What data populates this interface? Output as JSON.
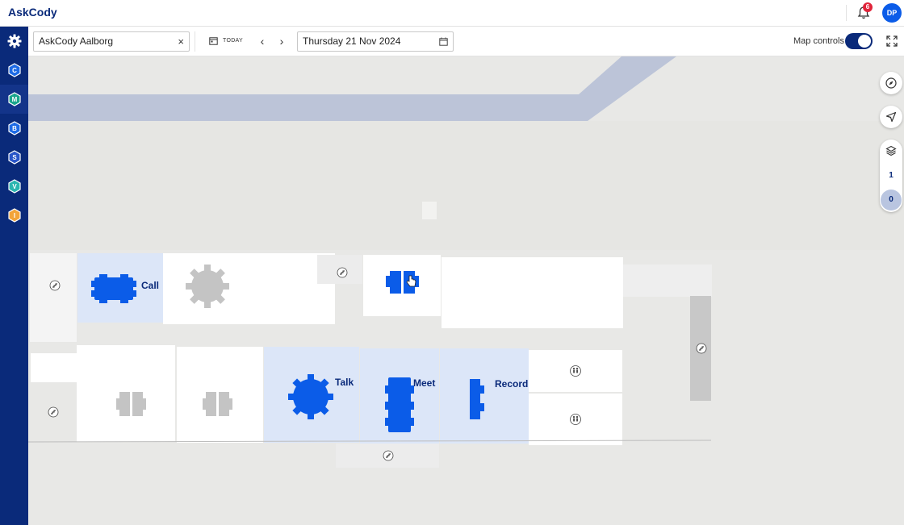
{
  "app": {
    "logo_text": "AskCody"
  },
  "header": {
    "notification_count": "6",
    "avatar_initials": "DP"
  },
  "sidebar": {
    "items": [
      {
        "name": "settings",
        "letter": ""
      },
      {
        "name": "module-c",
        "letter": "C",
        "color": "#1e6be6"
      },
      {
        "name": "module-m",
        "letter": "M",
        "color": "#1aa58c"
      },
      {
        "name": "module-b",
        "letter": "B",
        "color": "#1e6be6"
      },
      {
        "name": "module-s",
        "letter": "S",
        "color": "#2a56c8"
      },
      {
        "name": "module-v",
        "letter": "V",
        "color": "#2ab5b0"
      },
      {
        "name": "module-i",
        "letter": "I",
        "color": "#f2a43a"
      }
    ]
  },
  "toolbar": {
    "location_value": "AskCody Aalborg",
    "clear_symbol": "×",
    "today_label": "TODAY",
    "prev_symbol": "‹",
    "next_symbol": "›",
    "date_value": "Thursday 21 Nov 2024",
    "map_controls_label": "Map controls",
    "map_controls_on": true
  },
  "map": {
    "rooms": {
      "call": "Call",
      "talk": "Talk",
      "meet": "Meet",
      "record": "Record"
    },
    "floors": [
      "1",
      "0"
    ],
    "active_floor": "0"
  },
  "colors": {
    "brand_navy": "#0a2a7a",
    "accent_blue": "#0b5ce8",
    "room_highlight": "#dce6f8",
    "furniture_active": "#0b5ce8",
    "furniture_inactive": "#c4c4c4",
    "road": "#bcc4d8"
  }
}
